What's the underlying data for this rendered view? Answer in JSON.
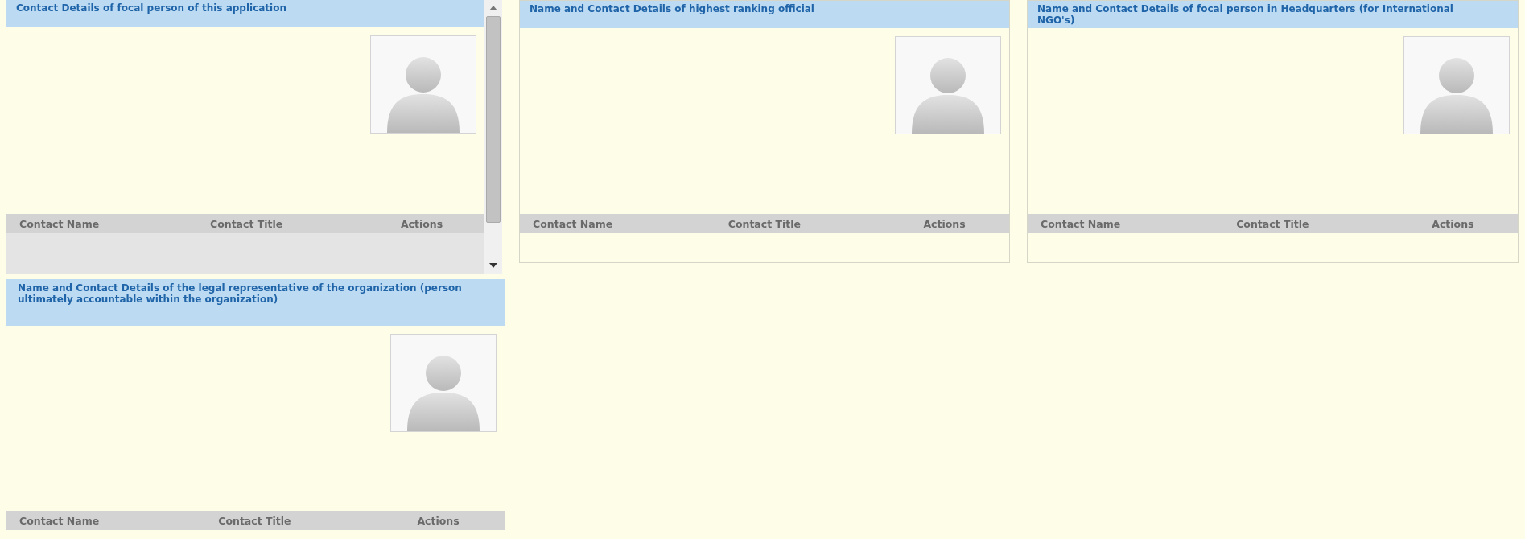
{
  "panels": [
    {
      "kind": "scrolled",
      "title": "Contact Details of focal person of this application",
      "columns": [
        "Contact Name",
        "Contact Title",
        "Actions"
      ]
    },
    {
      "kind": "plain",
      "title": "Name and Contact Details of highest ranking official",
      "columns": [
        "Contact Name",
        "Contact Title",
        "Actions"
      ]
    },
    {
      "kind": "plain",
      "title": "Name and Contact Details of focal person in Headquarters (for International NGO's)",
      "columns": [
        "Contact Name",
        "Contact Title",
        "Actions"
      ]
    },
    {
      "kind": "tall",
      "title": "Name and Contact Details of the legal representative of the organization (person ultimately accountable within the organization)",
      "columns": [
        "Contact Name",
        "Contact Title",
        "Actions"
      ]
    }
  ]
}
